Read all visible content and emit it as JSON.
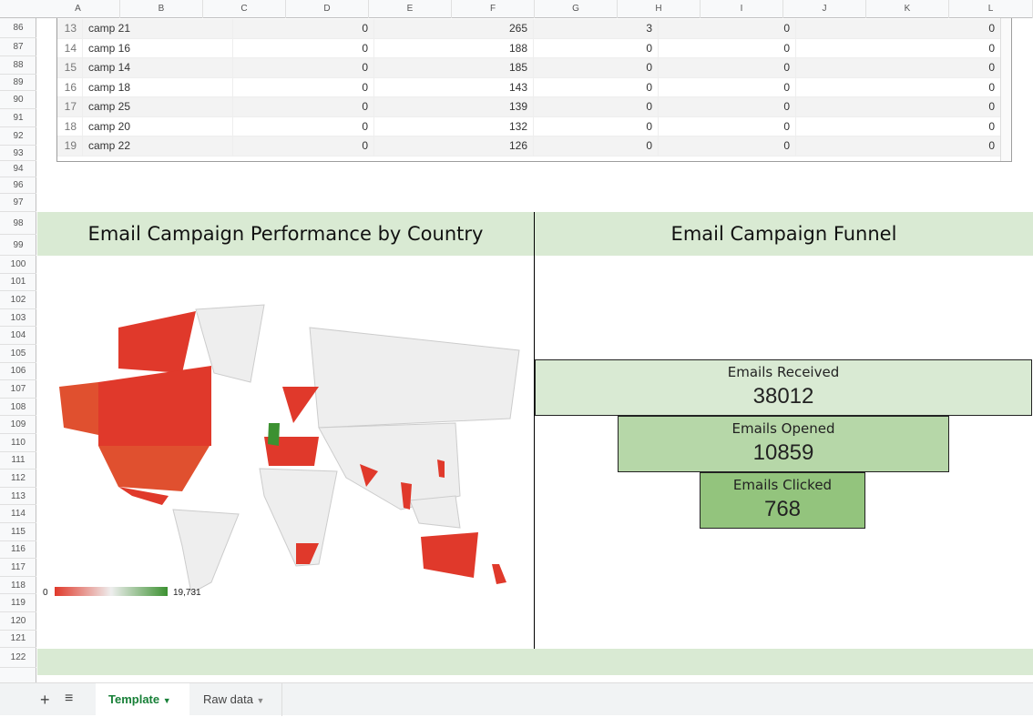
{
  "columns": [
    "A",
    "B",
    "C",
    "D",
    "E",
    "F",
    "G",
    "H",
    "I",
    "J",
    "K",
    "L"
  ],
  "rows": [
    "86",
    "87",
    "88",
    "89",
    "90",
    "91",
    "92",
    "93",
    "94",
    "96",
    "97",
    "98",
    "99",
    "100",
    "101",
    "102",
    "103",
    "104",
    "105",
    "106",
    "107",
    "108",
    "109",
    "110",
    "111",
    "112",
    "113",
    "114",
    "115",
    "116",
    "117",
    "118",
    "119",
    "120",
    "121",
    "122"
  ],
  "table": {
    "rows": [
      [
        "13",
        "camp 21",
        "0",
        "265",
        "3",
        "0",
        "0"
      ],
      [
        "14",
        "camp 16",
        "0",
        "188",
        "0",
        "0",
        "0"
      ],
      [
        "15",
        "camp 14",
        "0",
        "185",
        "0",
        "0",
        "0"
      ],
      [
        "16",
        "camp 18",
        "0",
        "143",
        "0",
        "0",
        "0"
      ],
      [
        "17",
        "camp 25",
        "0",
        "139",
        "0",
        "0",
        "0"
      ],
      [
        "18",
        "camp 20",
        "0",
        "132",
        "0",
        "0",
        "0"
      ],
      [
        "19",
        "camp 22",
        "0",
        "126",
        "0",
        "0",
        "0"
      ]
    ]
  },
  "map": {
    "title": "Email Campaign Performance by Country",
    "legend_min": "0",
    "legend_max": "19,731",
    "colors": {
      "low": "#e0392b",
      "high": "#3c9131",
      "none": "#eeeeee"
    }
  },
  "funnel": {
    "title": "Email Campaign Funnel",
    "stages": [
      {
        "label": "Emails Received",
        "value": "38012",
        "color": "#d9ead3"
      },
      {
        "label": "Emails Opened",
        "value": "10859",
        "color": "#b6d7a8"
      },
      {
        "label": "Emails Clicked",
        "value": "768",
        "color": "#93c47d"
      }
    ]
  },
  "sheets": {
    "tabs": [
      {
        "label": "Template",
        "active": true
      },
      {
        "label": "Raw data",
        "active": false
      }
    ],
    "add_icon": "plus-icon",
    "list_icon": "menu-icon"
  }
}
